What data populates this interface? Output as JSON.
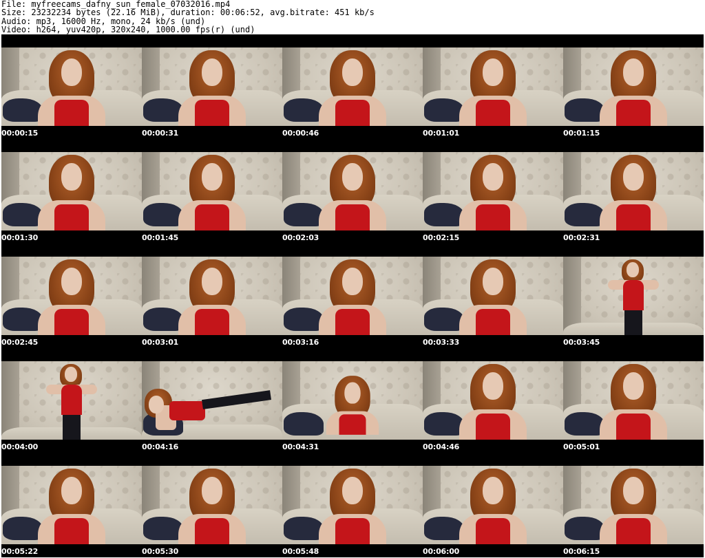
{
  "header": {
    "file_line": "File: myfreecams_dafny_sun_female_07032016.mp4",
    "size_line": "Size: 23232234 bytes (22.16 MiB), duration: 00:06:52, avg.bitrate: 451 kb/s",
    "audio_line": "Audio: mp3, 16000 Hz, mono, 24 kb/s (und)",
    "video_line": "Video: h264, yuv420p, 320x240, 1000.00 fps(r) (und)"
  },
  "colors": {
    "sheet_background": "#000000",
    "timestamp_text": "#ffffff",
    "top_garment": "#c4151a"
  },
  "thumbnails": [
    {
      "timestamp": "00:00:15",
      "pose": "sit"
    },
    {
      "timestamp": "00:00:31",
      "pose": "sit"
    },
    {
      "timestamp": "00:00:46",
      "pose": "sit"
    },
    {
      "timestamp": "00:01:01",
      "pose": "sit"
    },
    {
      "timestamp": "00:01:15",
      "pose": "sit"
    },
    {
      "timestamp": "00:01:30",
      "pose": "sit"
    },
    {
      "timestamp": "00:01:45",
      "pose": "sit"
    },
    {
      "timestamp": "00:02:03",
      "pose": "sit"
    },
    {
      "timestamp": "00:02:15",
      "pose": "sit"
    },
    {
      "timestamp": "00:02:31",
      "pose": "sit"
    },
    {
      "timestamp": "00:02:45",
      "pose": "sit"
    },
    {
      "timestamp": "00:03:01",
      "pose": "sit"
    },
    {
      "timestamp": "00:03:16",
      "pose": "sit"
    },
    {
      "timestamp": "00:03:33",
      "pose": "sit"
    },
    {
      "timestamp": "00:03:45",
      "pose": "stand"
    },
    {
      "timestamp": "00:04:00",
      "pose": "stand"
    },
    {
      "timestamp": "00:04:16",
      "pose": "floor"
    },
    {
      "timestamp": "00:04:31",
      "pose": "small"
    },
    {
      "timestamp": "00:04:46",
      "pose": "sit"
    },
    {
      "timestamp": "00:05:01",
      "pose": "sit"
    },
    {
      "timestamp": "00:05:22",
      "pose": "sit"
    },
    {
      "timestamp": "00:05:30",
      "pose": "sit"
    },
    {
      "timestamp": "00:05:48",
      "pose": "sit"
    },
    {
      "timestamp": "00:06:00",
      "pose": "sit"
    },
    {
      "timestamp": "00:06:15",
      "pose": "sit"
    }
  ]
}
